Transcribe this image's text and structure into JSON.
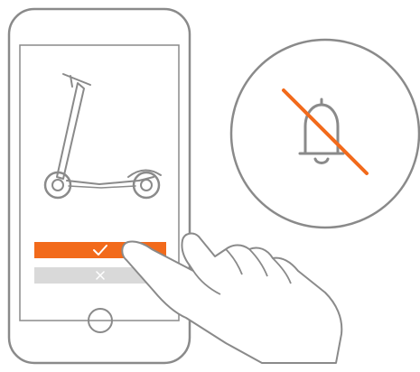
{
  "confirm_button": {
    "icon": "checkmark-icon",
    "color": "#f26a1b",
    "icon_color": "#ffffff"
  },
  "cancel_button": {
    "icon": "close-icon",
    "color": "#d9d9d9",
    "icon_color": "#ffffff"
  },
  "illustration": {
    "line_color": "#8a8a8a",
    "accent_color": "#f26a1b",
    "icons": [
      "phone-icon",
      "scooter-icon",
      "bell-muted-icon",
      "hand-icon",
      "home-button-icon"
    ]
  }
}
